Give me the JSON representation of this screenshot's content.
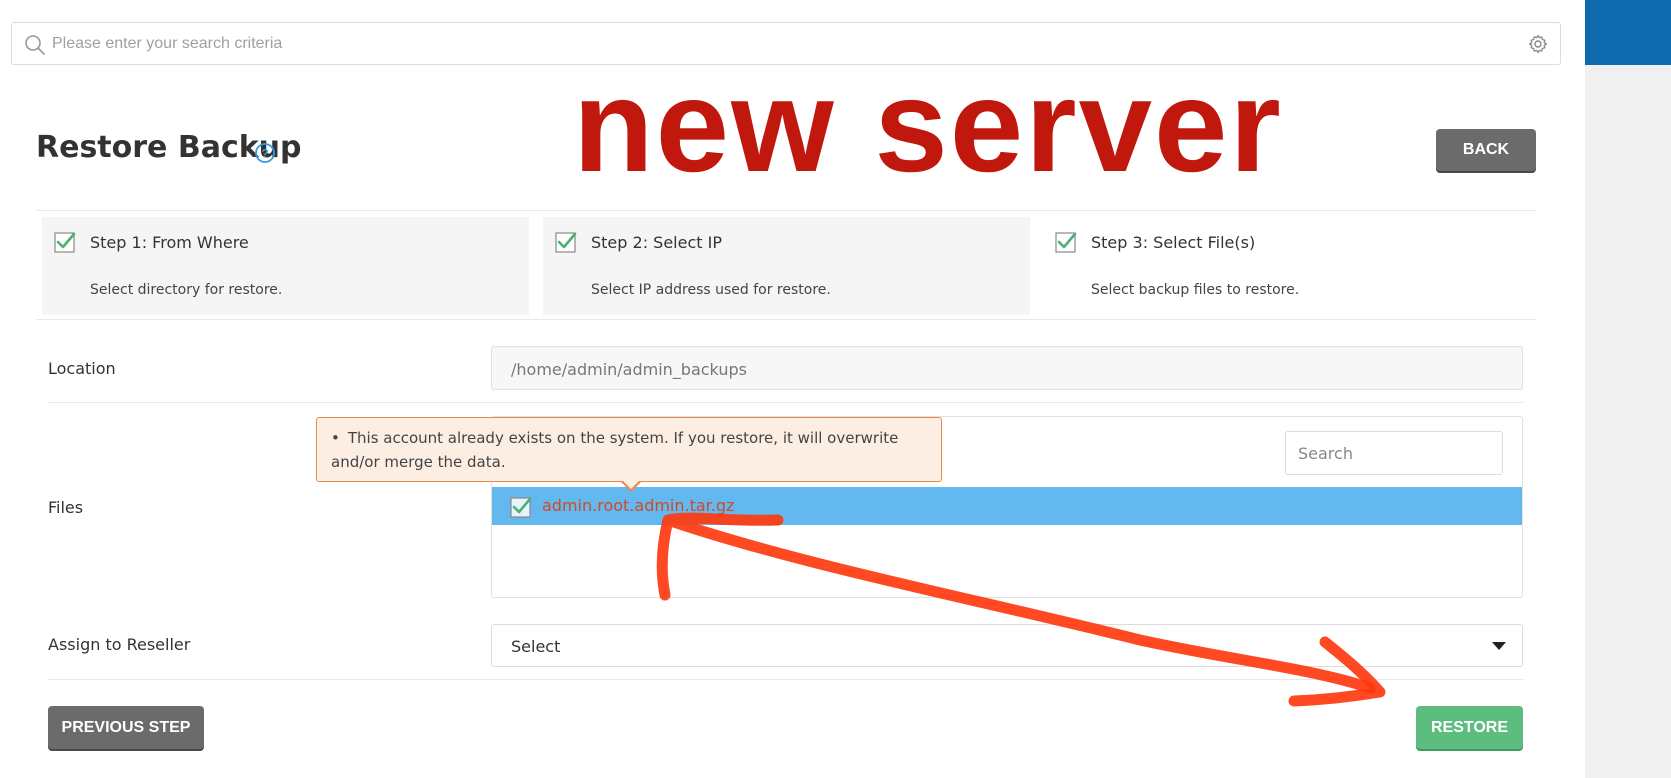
{
  "search": {
    "placeholder": "Please enter your search criteria"
  },
  "page": {
    "title": "Restore Backup"
  },
  "annotation": {
    "text": "new server",
    "color": "#c0180c"
  },
  "header": {
    "back_label": "BACK"
  },
  "steps": [
    {
      "title": "Step 1: From Where",
      "desc": "Select directory for restore.",
      "done": true
    },
    {
      "title": "Step 2: Select IP",
      "desc": "Select IP address used for restore.",
      "done": true
    },
    {
      "title": "Step 3: Select File(s)",
      "desc": "Select backup files to restore.",
      "done": true
    }
  ],
  "form": {
    "location_label": "Location",
    "location_value": "/home/admin/admin_backups",
    "files_label": "Files",
    "files_search_placeholder": "Search",
    "files": [
      {
        "name": "admin.root.admin.tar.gz",
        "checked": true
      }
    ],
    "warning": "This account already exists on the system. If you restore, it will overwrite and/or merge the data.",
    "reseller_label": "Assign to Reseller",
    "reseller_value": "Select"
  },
  "actions": {
    "previous_label": "PREVIOUS STEP",
    "restore_label": "RESTORE"
  },
  "colors": {
    "accent_blue": "#0e6aac",
    "selection": "#63b8f0",
    "success": "#5cbd7e",
    "check": "#4caf73"
  }
}
